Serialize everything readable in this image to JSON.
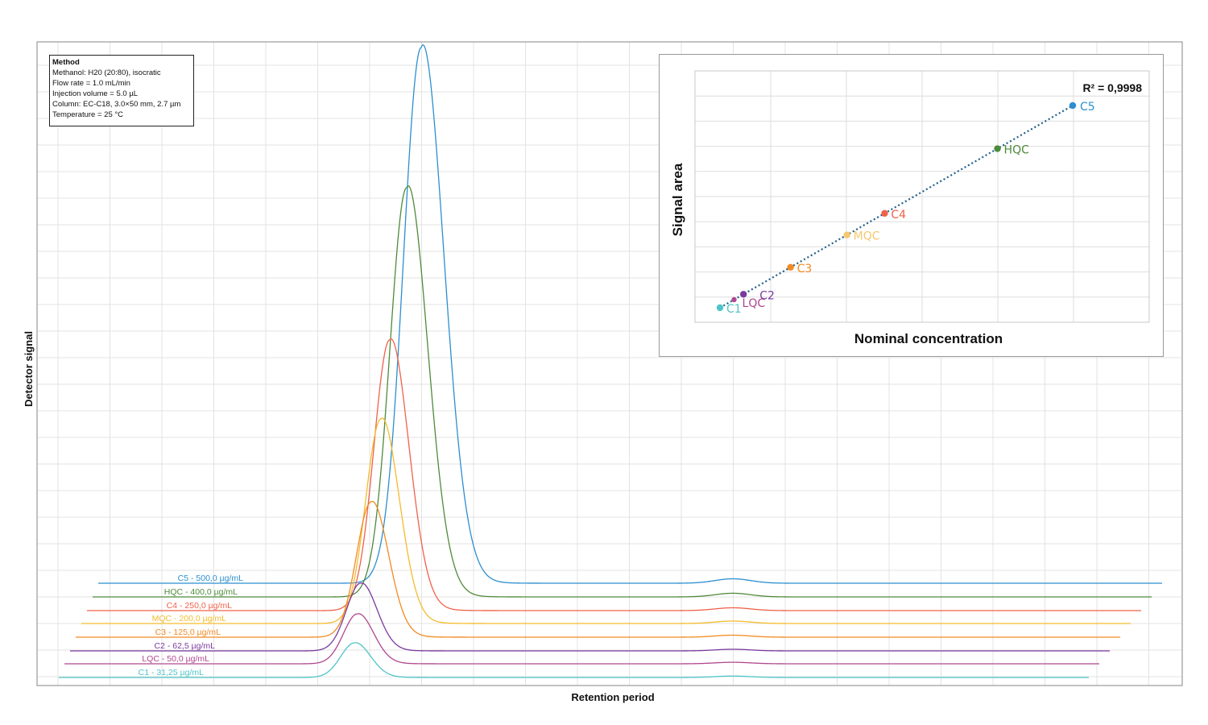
{
  "chart_data": [
    {
      "type": "line",
      "title": "",
      "xlabel": "Retention period",
      "ylabel": "Detector signal",
      "grid": true,
      "legend": "inline labels at left of each trace",
      "method": {
        "title": "Method",
        "lines": [
          "Methanol: H20 (20:80), isocratic",
          "Flow rate = 1.0 mL/min",
          "Injection volume = 5.0 µL",
          "Column: EC-C18, 3.0×50 mm, 2.7 µm",
          "Temperature = 25 °C"
        ]
      },
      "series": [
        {
          "name": "C5 - 500,0 µg/mL",
          "color": "#2b8fd0",
          "peak_height": 665,
          "baseline_offset": 117
        },
        {
          "name": "HQC - 400,0 µg/mL",
          "color": "#4e8a3a",
          "peak_height": 508,
          "baseline_offset": 100
        },
        {
          "name": "C4 - 250,0 µg/mL",
          "color": "#f0614a",
          "peak_height": 336,
          "baseline_offset": 83
        },
        {
          "name": "MQC - 200,0 µg/mL",
          "color": "#f5bb2c",
          "peak_height": 254,
          "baseline_offset": 67
        },
        {
          "name": "C3 - 125,0 µg/mL",
          "color": "#f28a22",
          "peak_height": 168,
          "baseline_offset": 50
        },
        {
          "name": "C2 - 62,5 µg/mL",
          "color": "#7a3a9e",
          "peak_height": 84,
          "baseline_offset": 33
        },
        {
          "name": "LQC - 50,0 µg/mL",
          "color": "#b0478f",
          "peak_height": 62,
          "baseline_offset": 17
        },
        {
          "name": "C1 - 31,25 µg/mL",
          "color": "#4fc4c8",
          "peak_height": 43,
          "baseline_offset": 0
        }
      ]
    },
    {
      "type": "scatter",
      "title": "",
      "xlabel": "Nominal concentration",
      "ylabel": "Signal area",
      "annotation": "R² = 0,9998",
      "trendline": "linear, dotted",
      "grid": true,
      "points": [
        {
          "label": "C1",
          "x": 31.25,
          "y": 31.25,
          "color": "#4fc4c8"
        },
        {
          "label": "LQC",
          "x": 50.0,
          "y": 50.0,
          "color": "#b0478f"
        },
        {
          "label": "C2",
          "x": 62.5,
          "y": 62.5,
          "color": "#7a3a9e"
        },
        {
          "label": "C3",
          "x": 125.0,
          "y": 125.0,
          "color": "#f28a22"
        },
        {
          "label": "MQC",
          "x": 200.0,
          "y": 200.0,
          "color": "#f5c870"
        },
        {
          "label": "C4",
          "x": 250.0,
          "y": 250.0,
          "color": "#f0614a"
        },
        {
          "label": "HQC",
          "x": 400.0,
          "y": 400.0,
          "color": "#4e8a3a"
        },
        {
          "label": "C5",
          "x": 500.0,
          "y": 500.0,
          "color": "#2b8fd0"
        }
      ]
    }
  ]
}
